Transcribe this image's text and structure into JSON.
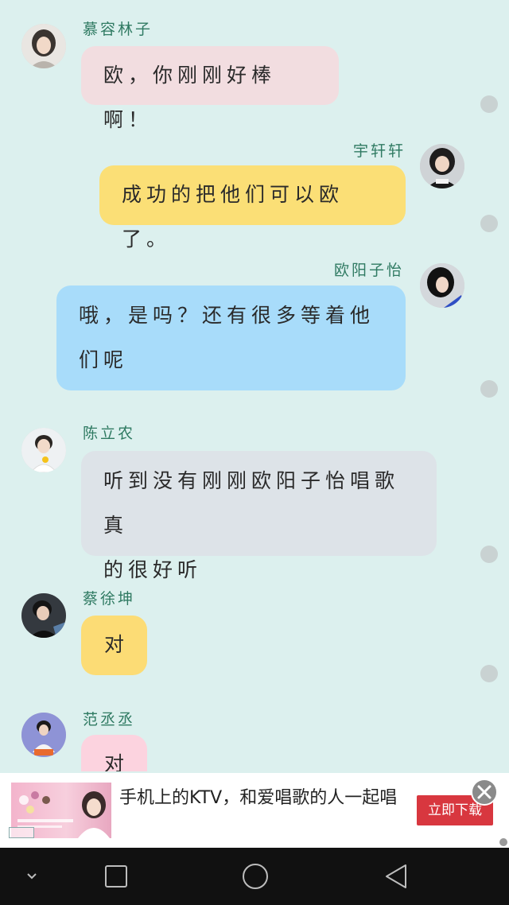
{
  "messages": [
    {
      "sender": "慕容林子",
      "text": "欧，你刚刚好棒啊！"
    },
    {
      "sender": "宇轩轩",
      "text": "成功的把他们可以欧了。"
    },
    {
      "sender": "欧阳子怡",
      "text_line1": "哦，是吗？还有很多等着他",
      "text_line2": "们呢"
    },
    {
      "sender": "陈立农",
      "text_line1": "听到没有刚刚欧阳子怡唱歌真",
      "text_line2": "的很好听"
    },
    {
      "sender": "蔡徐坤",
      "text": "对"
    },
    {
      "sender": "范丞丞",
      "text": "对"
    }
  ],
  "ad": {
    "title": "手机上的KTV，和爱唱歌的人一起唱",
    "cta": "立即下载",
    "close_icon": "close-icon"
  },
  "nav": {
    "icons": [
      "chevron-down-icon",
      "square-recents-icon",
      "circle-home-icon",
      "triangle-back-icon"
    ]
  },
  "colors": {
    "background": "#dcf0ee",
    "name": "#2f7a62",
    "bubble_pink": "#f2dde0",
    "bubble_yellow": "#fbdf76",
    "bubble_blue": "#a8dcfa",
    "bubble_gray": "#dde3e8",
    "bubble_gold": "#fcdc75",
    "bubble_rose": "#fcd3df",
    "ad_button": "#d8373f"
  }
}
